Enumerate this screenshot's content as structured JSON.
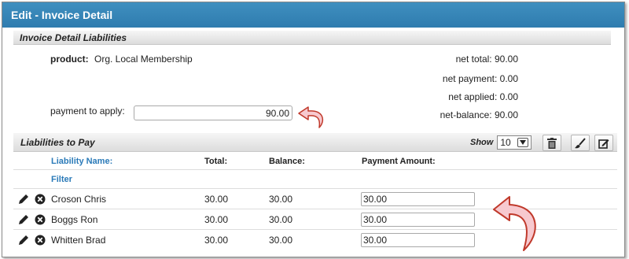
{
  "window": {
    "title": "Edit - Invoice Detail"
  },
  "detail_section": {
    "title": "Invoice Detail Liabilities"
  },
  "product": {
    "label": "product:",
    "value": "Org. Local Membership"
  },
  "payment_to_apply": {
    "label": "payment to apply:",
    "value": "90.00"
  },
  "totals": [
    {
      "label": "net total:",
      "value": "90.00"
    },
    {
      "label": "net payment:",
      "value": "0.00"
    },
    {
      "label": "net applied:",
      "value": "0.00"
    },
    {
      "label": "net-balance:",
      "value": "90.00"
    }
  ],
  "liabilities_section": {
    "title": "Liabilities to Pay",
    "show_label": "Show",
    "show_value": "10"
  },
  "table": {
    "headers": {
      "name": "Liability Name:",
      "total": "Total:",
      "balance": "Balance:",
      "payment": "Payment Amount:"
    },
    "filter_label": "Filter",
    "rows": [
      {
        "name": "Croson Chris",
        "total": "30.00",
        "balance": "30.00",
        "payment": "30.00"
      },
      {
        "name": "Boggs Ron",
        "total": "30.00",
        "balance": "30.00",
        "payment": "30.00"
      },
      {
        "name": "Whitten Brad",
        "total": "30.00",
        "balance": "30.00",
        "payment": "30.00"
      }
    ]
  },
  "colors": {
    "title_bar": "#3a88bb",
    "link_blue": "#2a7ab8",
    "arrow_fill": "#f7c9cf",
    "arrow_stroke": "#c0392b"
  },
  "icons": [
    "trash-icon",
    "brush-icon",
    "edit-box-icon",
    "pencil-icon",
    "delete-circle-icon",
    "curved-arrow-icon"
  ]
}
